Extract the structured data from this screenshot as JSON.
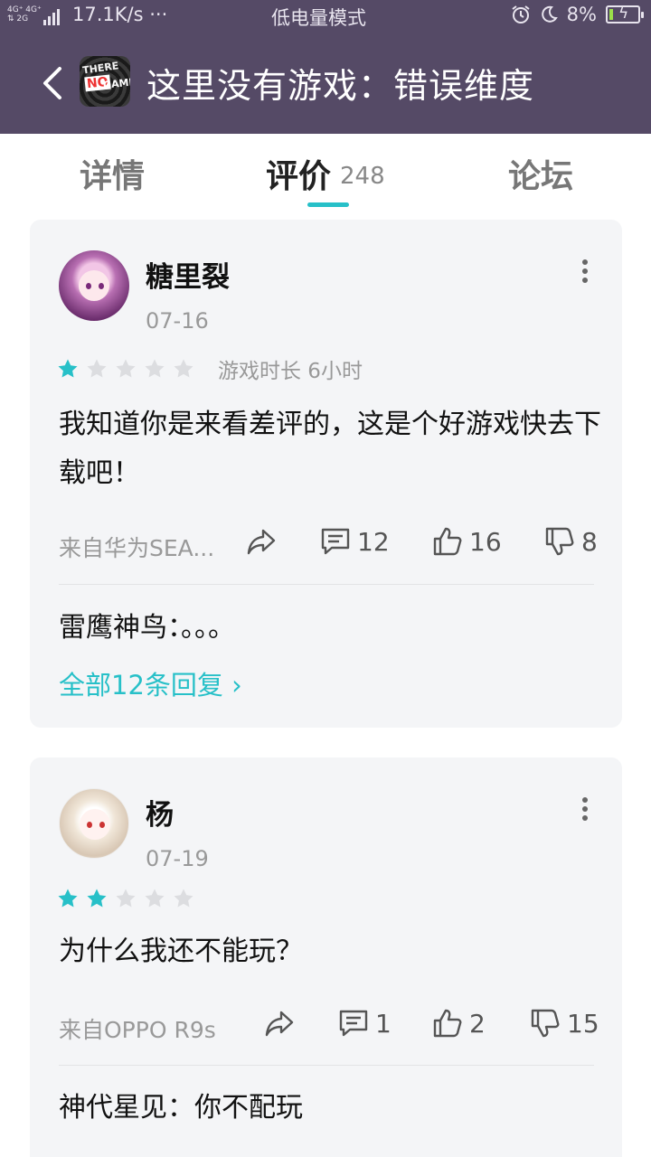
{
  "status_bar": {
    "network_top": "4G⁺ 4G⁺",
    "network_bottom": "⇅ 2G",
    "speed": "17.1K/s ···",
    "mode": "低电量模式",
    "battery": "8%"
  },
  "header": {
    "title": "这里没有游戏：错误维度",
    "app_icon_text": [
      "THERE IS",
      "NO",
      "GAME"
    ]
  },
  "tabs": {
    "details": "详情",
    "reviews": "评价",
    "reviews_count": "248",
    "forum": "论坛"
  },
  "colors": {
    "header_bg": "#554a66",
    "accent": "#27c0c8",
    "card_bg": "#f4f5f7",
    "star_empty": "#dcdde0"
  },
  "reviews": [
    {
      "user": "糖里裂",
      "date": "07-16",
      "rating": 1,
      "playtime": "游戏时长 6小时",
      "content": "我知道你是来看差评的，这是个好游戏快去下载吧！",
      "source": "来自华为SEA...",
      "comments": "12",
      "likes": "16",
      "dislikes": "8",
      "reply": "雷鹰神鸟：。。。",
      "all_replies": "全部12条回复 ›"
    },
    {
      "user": "杨",
      "date": "07-19",
      "rating": 2,
      "content": "为什么我还不能玩？",
      "source": "来自OPPO R9s",
      "comments": "1",
      "likes": "2",
      "dislikes": "15",
      "reply": "神代星见：你不配玩"
    }
  ]
}
